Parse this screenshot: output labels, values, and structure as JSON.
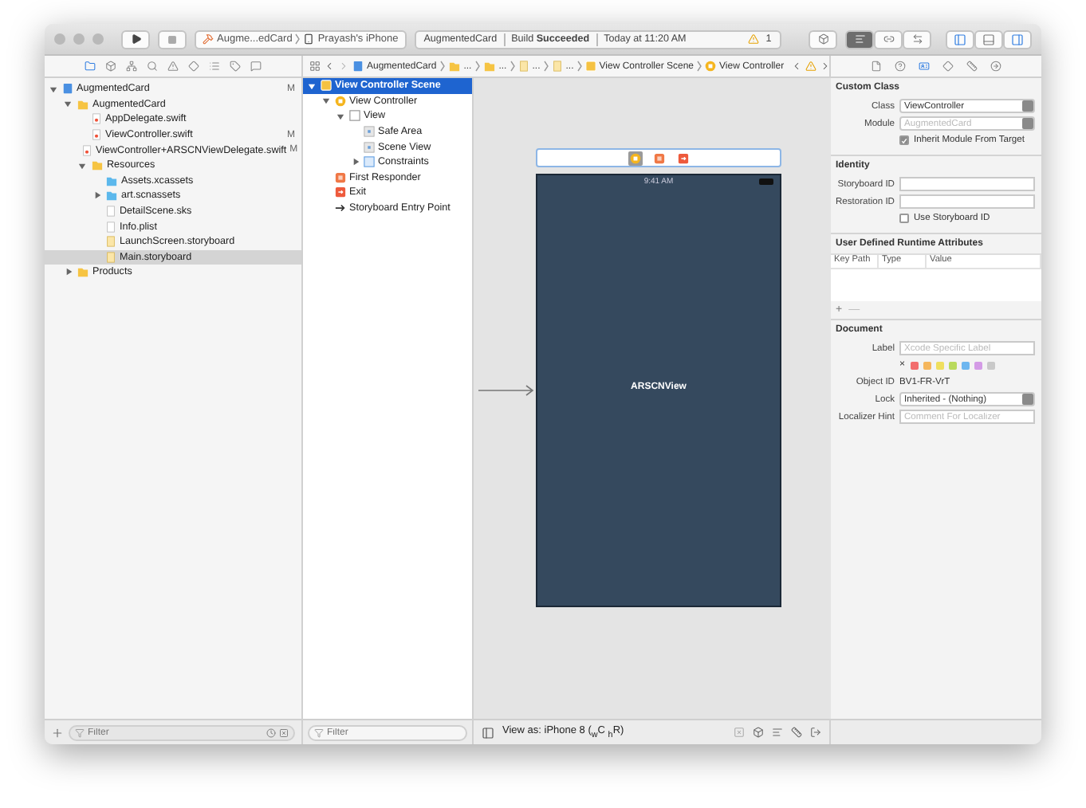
{
  "toolbar": {
    "scheme": "Augme...edCard",
    "device": "Prayash's iPhone",
    "project": "AugmentedCard",
    "status": "Build **Succeeded**",
    "time": "Today at 11:20 AM",
    "warnings": "1",
    "editors": [
      {
        "kind": "standard",
        "selected": true
      },
      {
        "kind": "assistant",
        "selected": false
      },
      {
        "kind": "version",
        "selected": false
      }
    ],
    "panels": [
      {
        "kind": "navigator",
        "on": true
      },
      {
        "kind": "debug",
        "on": false
      },
      {
        "kind": "inspector",
        "on": true
      }
    ]
  },
  "navigator": {
    "tabs": [
      {
        "kind": "folder",
        "selected": true
      },
      {
        "kind": "box",
        "selected": false
      },
      {
        "kind": "network",
        "selected": false
      },
      {
        "kind": "search",
        "selected": false
      },
      {
        "kind": "warning",
        "selected": false
      },
      {
        "kind": "diamond",
        "selected": false
      },
      {
        "kind": "list",
        "selected": false
      },
      {
        "kind": "tag",
        "selected": false
      },
      {
        "kind": "message",
        "selected": false
      }
    ],
    "tree": [
      {
        "label": "AugmentedCard",
        "kind": "project",
        "badge": "M",
        "selected": false,
        "expanded": true,
        "children": [
          {
            "label": "AugmentedCard",
            "kind": "folder",
            "selected": false,
            "expanded": true,
            "children": [
              {
                "label": "AppDelegate.swift",
                "kind": "swift",
                "selected": false
              },
              {
                "label": "ViewController.swift",
                "kind": "swift",
                "badge": "M",
                "selected": false
              },
              {
                "label": "ViewController+ARSCNViewDelegate.swift",
                "kind": "swift",
                "badge": "M",
                "selected": false
              },
              {
                "label": "Resources",
                "kind": "folder",
                "selected": false,
                "expanded": true,
                "children": [
                  {
                    "label": "Assets.xcassets",
                    "kind": "assets",
                    "selected": false
                  },
                  {
                    "label": "art.scnassets",
                    "kind": "assets",
                    "selected": false,
                    "expanded": false
                  },
                  {
                    "label": "DetailScene.sks",
                    "kind": "file",
                    "selected": false
                  },
                  {
                    "label": "Info.plist",
                    "kind": "file",
                    "selected": false
                  },
                  {
                    "label": "LaunchScreen.storyboard",
                    "kind": "storyboard",
                    "selected": false
                  },
                  {
                    "label": "Main.storyboard",
                    "kind": "storyboard",
                    "selected": true
                  }
                ]
              }
            ]
          },
          {
            "label": "Products",
            "kind": "folder",
            "selected": false,
            "expanded": false
          }
        ]
      }
    ],
    "filter": {
      "placeholder": "Filter"
    }
  },
  "jump_bar": [
    {
      "label": "AugmentedCard",
      "kind": "project"
    },
    {
      "label": "...",
      "kind": "folder"
    },
    {
      "label": "...",
      "kind": "folder"
    },
    {
      "label": "...",
      "kind": "storyboard"
    },
    {
      "label": "...",
      "kind": "storyboard"
    },
    {
      "label": "View Controller Scene",
      "kind": "scene"
    },
    {
      "label": "View Controller",
      "kind": "controller"
    }
  ],
  "outline": {
    "tree": [
      {
        "label": "View Controller Scene",
        "kind": "scene",
        "selected": true,
        "expanded": true,
        "children": [
          {
            "label": "View Controller",
            "kind": "controller",
            "selected": false,
            "expanded": true,
            "children": [
              {
                "label": "View",
                "kind": "view",
                "selected": false,
                "expanded": true,
                "children": [
                  {
                    "label": "Safe Area",
                    "kind": "safearea",
                    "selected": false
                  },
                  {
                    "label": "Scene View",
                    "kind": "safearea",
                    "selected": false
                  },
                  {
                    "label": "Constraints",
                    "kind": "constraints",
                    "selected": false,
                    "expanded": false
                  }
                ]
              }
            ]
          },
          {
            "label": "First Responder",
            "kind": "responder",
            "selected": false
          },
          {
            "label": "Exit",
            "kind": "exit",
            "selected": false
          },
          {
            "label": "Storyboard Entry Point",
            "kind": "entry",
            "selected": false
          }
        ]
      }
    ],
    "filter": {
      "placeholder": "Filter"
    }
  },
  "canvas": {
    "scene_icons": [
      {
        "kind": "controller",
        "selected": true
      },
      {
        "kind": "responder",
        "selected": false
      },
      {
        "kind": "exit",
        "selected": false
      }
    ],
    "status_time": "9:41 AM",
    "view_label": "ARSCNView",
    "view_as": "View as: iPhone 8 ($_{w}$C $_{h}$R)"
  },
  "inspector": {
    "tabs": [
      {
        "kind": "file",
        "selected": false
      },
      {
        "kind": "help",
        "selected": false
      },
      {
        "kind": "identity",
        "selected": true
      },
      {
        "kind": "attributes",
        "selected": false
      },
      {
        "kind": "size",
        "selected": false
      },
      {
        "kind": "connections",
        "selected": false
      }
    ],
    "custom_class": {
      "title": "Custom Class",
      "class_label": "Class",
      "class_value": "ViewController",
      "module_label": "Module",
      "module_placeholder": "AugmentedCard",
      "inherit": {
        "label": "Inherit Module From Target",
        "checked": true
      }
    },
    "identity": {
      "title": "Identity",
      "storyboard_id_label": "Storyboard ID",
      "restoration_id_label": "Restoration ID",
      "use_storyboard_id": {
        "label": "Use Storyboard ID",
        "checked": false
      }
    },
    "runtime_attributes": {
      "title": "User Defined Runtime Attributes",
      "columns": [
        "Key Path",
        "Type",
        "Value"
      ],
      "add": "+",
      "remove": "—"
    },
    "document": {
      "title": "Document",
      "label_label": "Label",
      "label_placeholder": "Xcode Specific Label",
      "clear": "×",
      "colors": [
        {
          "color": "#f26d6d"
        },
        {
          "color": "#f5b65c"
        },
        {
          "color": "#efdf5e"
        },
        {
          "color": "#b9da5c"
        },
        {
          "color": "#6db6ef"
        },
        {
          "color": "#d49be6"
        },
        {
          "color": "#c9c9c9"
        }
      ],
      "object_id_label": "Object ID",
      "object_id": "BV1-FR-VrT",
      "lock_label": "Lock",
      "lock_value": "Inherited - (Nothing)",
      "hint_label": "Localizer Hint",
      "hint_placeholder": "Comment For Localizer"
    }
  }
}
